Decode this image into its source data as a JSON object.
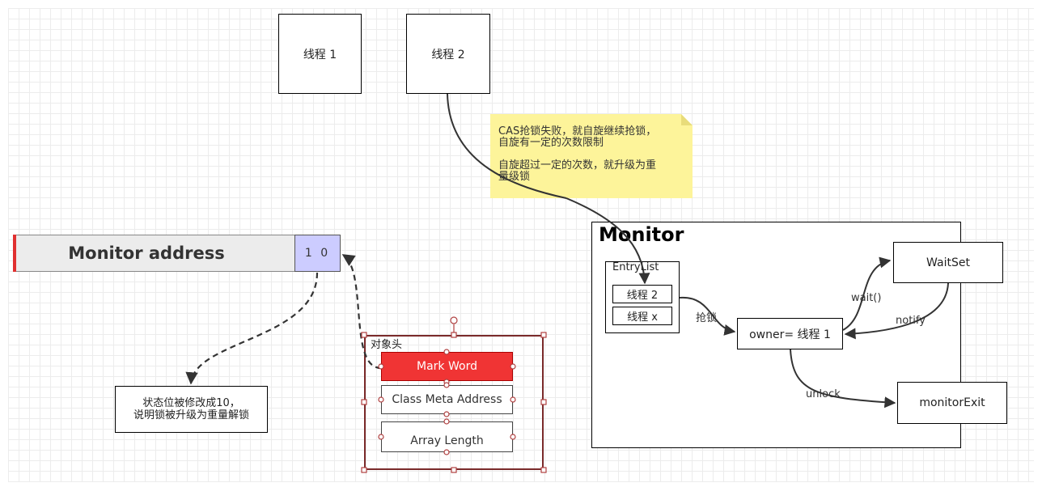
{
  "threads": {
    "thread1": "线程 1",
    "thread2": "线程 2"
  },
  "note": {
    "line1": "CAS抢锁失败，就自旋继续抢锁，",
    "line2": "自旋有一定的次数限制",
    "line3": "自旋超过一定的次数，就升级为重",
    "line4": "量级锁"
  },
  "monitor": {
    "title": "Monitor",
    "entry_list": {
      "title": "EntryList",
      "items": [
        "线程 2",
        "线程 x"
      ]
    },
    "grab_label": "抢锁",
    "owner": "owner= 线程 1",
    "waitset": "WaitSet",
    "wait_label": "wait()",
    "notify_label": "notify",
    "unlock_label": "unlock",
    "monitor_exit": "monitorExit"
  },
  "mark_word_bar": {
    "label": "Monitor address",
    "bits": "1 0"
  },
  "state_note": {
    "line1": "状态位被修改成10，",
    "line2": "说明锁被升级为重量解锁"
  },
  "object_header": {
    "title": "对象头",
    "rows": [
      "Mark Word",
      "Class Meta Address",
      "Array Length"
    ]
  },
  "colors": {
    "note_bg": "#fdf49a",
    "mark_word_bg": "#f03434",
    "bits_bg": "#ccccff",
    "selection": "#7a2a2a"
  }
}
